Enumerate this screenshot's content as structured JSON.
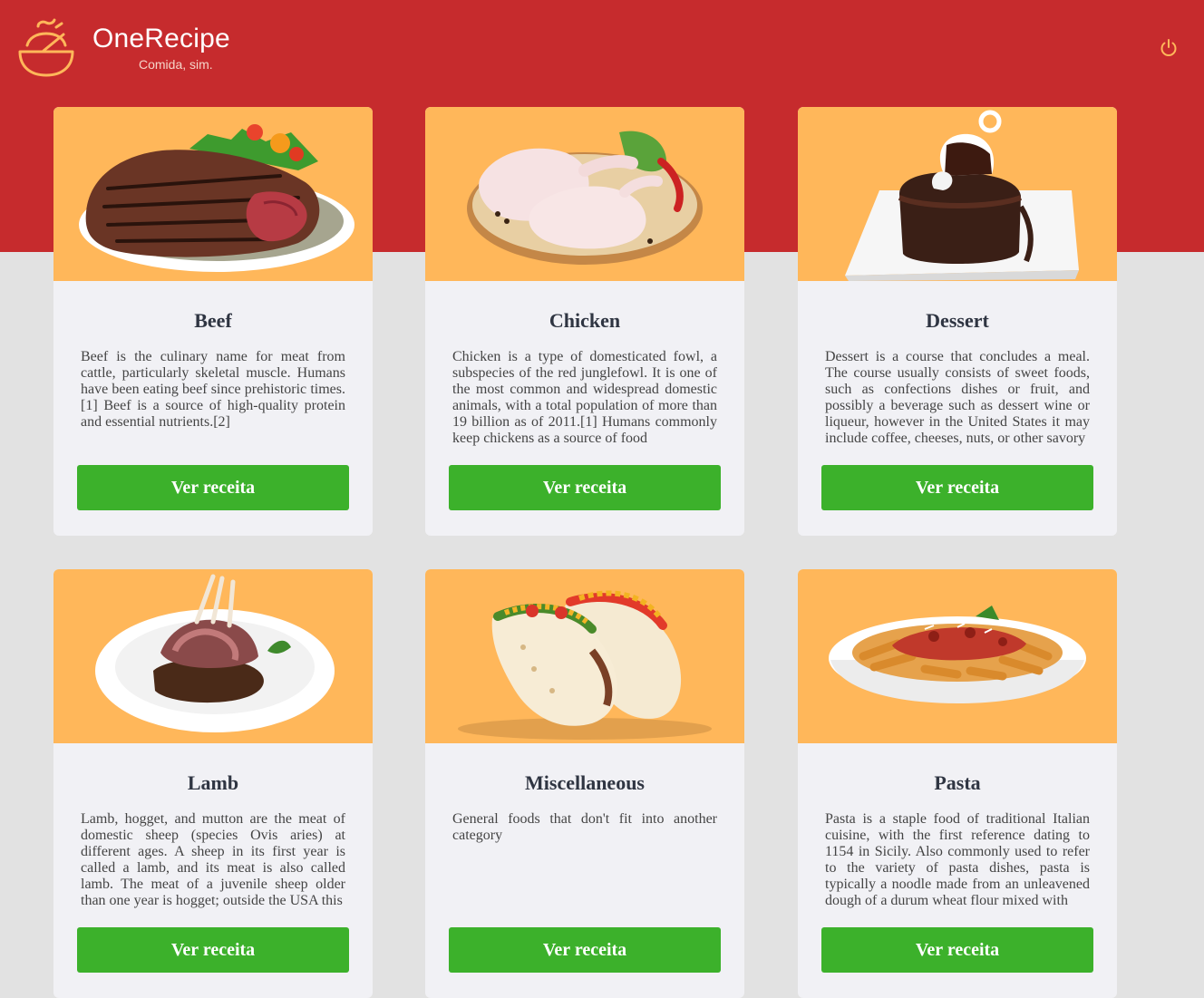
{
  "header": {
    "brand_name": "OneRecipe",
    "tagline": "Comida, sim.",
    "logo_icon": "bowl-icon",
    "logout_icon": "power-icon"
  },
  "colors": {
    "header_red": "#c62b2d",
    "card_media": "#ffb75a",
    "button_green": "#3cb12b",
    "page_background": "#e2e2e2"
  },
  "categories": [
    {
      "title": "Beef",
      "description": "Beef is the culinary name for meat from cattle, particularly skeletal muscle. Humans have been eating beef since prehistoric times.[1] Beef is a source of high-quality protein and essential nutrients.[2]",
      "button_label": "Ver receita"
    },
    {
      "title": "Chicken",
      "description": "Chicken is a type of domesticated fowl, a subspecies of the red junglefowl. It is one of the most common and widespread domestic animals, with a total population of more than 19 billion as of 2011.[1] Humans commonly keep chickens as a source of food",
      "button_label": "Ver receita"
    },
    {
      "title": "Dessert",
      "description": "Dessert is a course that concludes a meal. The course usually consists of sweet foods, such as confections dishes or fruit, and possibly a beverage such as dessert wine or liqueur, however in the United States it may include coffee, cheeses, nuts, or other savory",
      "button_label": "Ver receita"
    },
    {
      "title": "Lamb",
      "description": "Lamb, hogget, and mutton are the meat of domestic sheep (species Ovis aries) at different ages. A sheep in its first year is called a lamb, and its meat is also called lamb. The meat of a juvenile sheep older than one year is hogget; outside the USA this",
      "button_label": "Ver receita"
    },
    {
      "title": "Miscellaneous",
      "description": "General foods that don't fit into another category",
      "button_label": "Ver receita"
    },
    {
      "title": "Pasta",
      "description": "Pasta is a staple food of traditional Italian cuisine, with the first reference dating to 1154 in Sicily. Also commonly used to refer to the variety of pasta dishes, pasta is typically a noodle made from an unleavened dough of a durum wheat flour mixed with",
      "button_label": "Ver receita"
    }
  ]
}
